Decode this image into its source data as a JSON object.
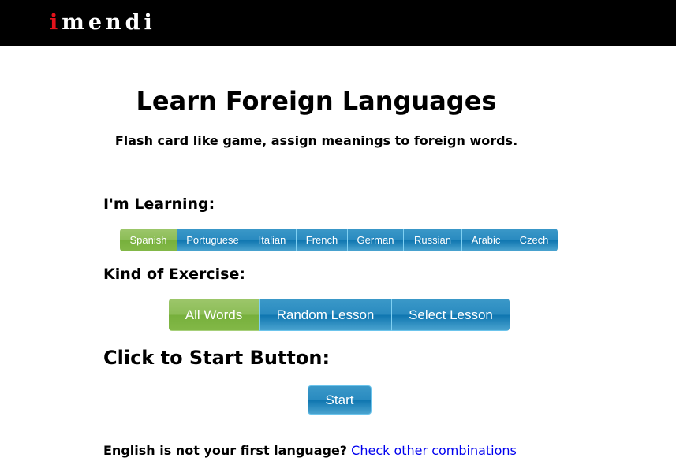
{
  "header": {
    "logo_first": "i",
    "logo_rest": "mendi"
  },
  "main": {
    "title": "Learn Foreign Languages",
    "subtitle": "Flash card like game, assign meanings to foreign words.",
    "learning_heading": "I'm Learning:",
    "languages": [
      {
        "label": "Spanish",
        "selected": true
      },
      {
        "label": "Portuguese",
        "selected": false
      },
      {
        "label": "Italian",
        "selected": false
      },
      {
        "label": "French",
        "selected": false
      },
      {
        "label": "German",
        "selected": false
      },
      {
        "label": "Russian",
        "selected": false
      },
      {
        "label": "Arabic",
        "selected": false
      },
      {
        "label": "Czech",
        "selected": false
      }
    ],
    "exercise_heading": "Kind of Exercise:",
    "exercises": [
      {
        "label": "All Words",
        "selected": true
      },
      {
        "label": "Random Lesson",
        "selected": false
      },
      {
        "label": "Select Lesson",
        "selected": false
      }
    ],
    "start_heading": "Click to Start Button:",
    "start_label": "Start"
  },
  "footer": {
    "question": "English is not your first language?",
    "link_text": "Check other combinations"
  },
  "colors": {
    "selected": "#8cbd57",
    "button": "#2a8bc0",
    "logo_accent": "#e3121b",
    "link": "#0000ee"
  }
}
